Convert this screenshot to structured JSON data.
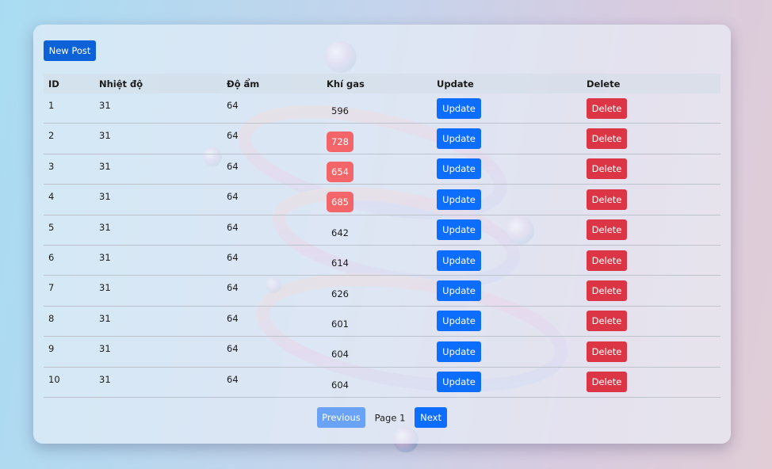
{
  "toolbar": {
    "new_post_label": "New Post"
  },
  "table": {
    "headers": [
      "ID",
      "Nhiệt độ",
      "Độ ẩm",
      "Khí gas",
      "Update",
      "Delete"
    ],
    "rows": [
      {
        "id": "1",
        "temp": "31",
        "humidity": "64",
        "gas": "596",
        "alert": false
      },
      {
        "id": "2",
        "temp": "31",
        "humidity": "64",
        "gas": "728",
        "alert": true
      },
      {
        "id": "3",
        "temp": "31",
        "humidity": "64",
        "gas": "654",
        "alert": true
      },
      {
        "id": "4",
        "temp": "31",
        "humidity": "64",
        "gas": "685",
        "alert": true
      },
      {
        "id": "5",
        "temp": "31",
        "humidity": "64",
        "gas": "642",
        "alert": false
      },
      {
        "id": "6",
        "temp": "31",
        "humidity": "64",
        "gas": "614",
        "alert": false
      },
      {
        "id": "7",
        "temp": "31",
        "humidity": "64",
        "gas": "626",
        "alert": false
      },
      {
        "id": "8",
        "temp": "31",
        "humidity": "64",
        "gas": "601",
        "alert": false
      },
      {
        "id": "9",
        "temp": "31",
        "humidity": "64",
        "gas": "604",
        "alert": false
      },
      {
        "id": "10",
        "temp": "31",
        "humidity": "64",
        "gas": "604",
        "alert": false
      }
    ],
    "update_label": "Update",
    "delete_label": "Delete"
  },
  "pagination": {
    "previous_label": "Previous",
    "page_text": "Page 1",
    "next_label": "Next"
  },
  "colors": {
    "primary": "#0d6efd",
    "danger": "#dc3545",
    "alert_badge": "#f36568",
    "previous_disabled": "#6aa3f5"
  }
}
